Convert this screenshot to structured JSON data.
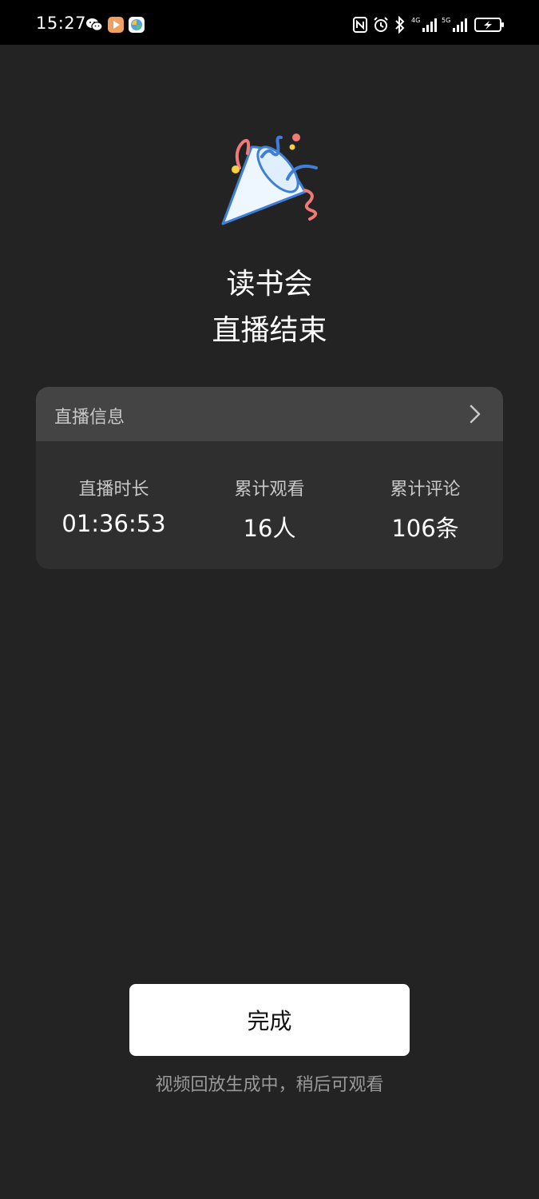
{
  "status_bar": {
    "time": "15:27",
    "network_1": "4G",
    "network_2": "5G"
  },
  "header": {
    "title_line_1": "读书会",
    "title_line_2": "直播结束"
  },
  "info_card": {
    "header_label": "直播信息",
    "stats": [
      {
        "label": "直播时长",
        "value": "01:36:53"
      },
      {
        "label": "累计观看",
        "value": "16人"
      },
      {
        "label": "累计评论",
        "value": "106条"
      }
    ]
  },
  "footer": {
    "done_label": "完成",
    "hint": "视频回放生成中，稍后可观看"
  },
  "colors": {
    "background": "#232324",
    "card": "#2f2f30",
    "card_header": "#444445",
    "button": "#ffffff"
  }
}
